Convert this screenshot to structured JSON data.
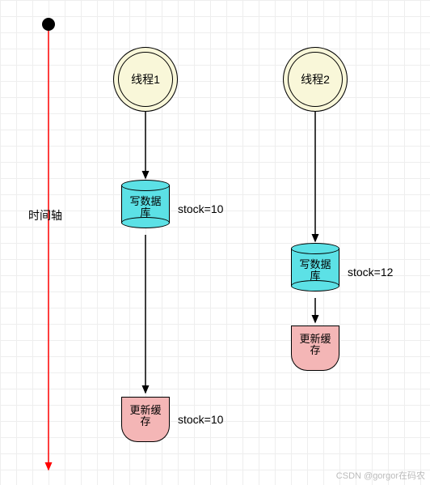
{
  "timeline": {
    "label": "时间轴",
    "color": "#ff0000"
  },
  "threads": [
    {
      "name": "线程1",
      "db": {
        "label": "写数据\n库",
        "annotation": "stock=10"
      },
      "cache": {
        "label": "更新缓\n存",
        "annotation": "stock=10"
      }
    },
    {
      "name": "线程2",
      "db": {
        "label": "写数据\n库",
        "annotation": "stock=12"
      },
      "cache": {
        "label": "更新缓\n存",
        "annotation": ""
      }
    }
  ],
  "colors": {
    "start_fill": "#f9f7d9",
    "db_fill": "#5ce1e6",
    "cache_fill": "#f4b6b6"
  },
  "watermark": "CSDN @gorgor在码农"
}
